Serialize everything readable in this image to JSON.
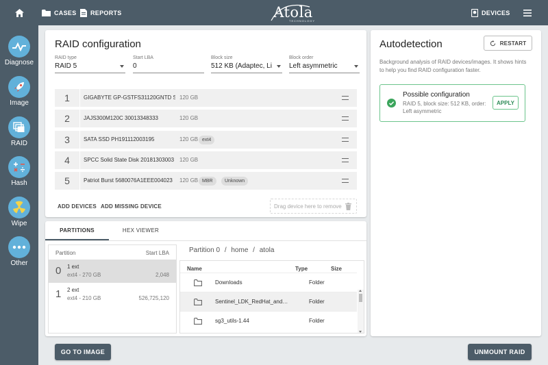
{
  "topbar": {
    "cases_label": "CASES",
    "reports_label": "REPORTS",
    "logo_text": "Atola",
    "logo_sub": "TECHNOLOGY",
    "devices_label": "DEVICES",
    "home_icon": "home-icon",
    "menu_icon": "hamburger-menu-icon"
  },
  "sidebar": {
    "items": [
      {
        "label": "Diagnose",
        "icon": "diagnose-icon"
      },
      {
        "label": "Image",
        "icon": "rocket-icon"
      },
      {
        "label": "RAID",
        "icon": "raid-stack-icon"
      },
      {
        "label": "Hash",
        "icon": "hash-math-icon"
      },
      {
        "label": "Wipe",
        "icon": "radiation-icon"
      },
      {
        "label": "Other",
        "icon": "more-dots-icon"
      }
    ],
    "accent": "#62b1da"
  },
  "raid": {
    "title": "RAID configuration",
    "fields": {
      "type": {
        "label": "RAID type",
        "value": "RAID 5"
      },
      "start_lba": {
        "label": "Start LBA",
        "value": "0"
      },
      "block_size": {
        "label": "Block size",
        "value": "512 KB (Adaptec, Li..."
      },
      "block_order": {
        "label": "Block order",
        "value": "Left asymmetric"
      }
    },
    "devices": [
      {
        "num": "1",
        "name": "GIGABYTE GP-GSTFS31120GNTD S",
        "size": "120 GB",
        "tags": []
      },
      {
        "num": "2",
        "name": "JAJS300M120C 30013348333",
        "size": "120 GB",
        "tags": []
      },
      {
        "num": "3",
        "name": "SATA SSD PH191112003195",
        "size": "120 GB",
        "tags": [
          "ext4"
        ]
      },
      {
        "num": "4",
        "name": "SPCC Solid State Disk 20181303003",
        "size": "120 GB",
        "tags": []
      },
      {
        "num": "5",
        "name": "Patriot Burst 5680076A1EEE004023",
        "size": "120 GB",
        "tags": [
          "MBR",
          "Unknown"
        ]
      }
    ],
    "add_devices": "ADD DEVICES",
    "add_missing": "ADD MISSING DEVICE",
    "drop_hint": "Drag device here to remove"
  },
  "auto": {
    "title": "Autodetection",
    "restart": "RESTART",
    "desc": "Background analysis of RAID devices/images. It shows hints to help you find RAID configuration faster.",
    "config_title": "Possible configuration",
    "config_desc": "RAID 5, block size: 512 KB, order: Left asymmetric",
    "apply": "APPLY",
    "success_color": "#3ba55c"
  },
  "partitions": {
    "tabs": [
      "PARTITIONS",
      "HEX VIEWER"
    ],
    "col_partition": "Partition",
    "col_start": "Start LBA",
    "rows": [
      {
        "num": "0",
        "name": "1 ext",
        "info": "ext4 - 270 GB",
        "lba": "2,048"
      },
      {
        "num": "1",
        "name": "2 ext",
        "info": "ext4 - 210 GB",
        "lba": "526,725,120"
      }
    ],
    "breadcrumb": [
      "Partition 0",
      "/",
      "home",
      "/",
      "atola"
    ],
    "file_cols": {
      "name": "Name",
      "type": "Type",
      "size": "Size"
    },
    "files": [
      {
        "name": "Downloads",
        "type": "Folder"
      },
      {
        "name": "Sentinel_LDK_RedHat_and..._RPM",
        "type": "Folder"
      },
      {
        "name": "sg3_utils-1.44",
        "type": "Folder"
      }
    ]
  },
  "bottom": {
    "go_to_image": "GO TO IMAGE",
    "unmount": "UNMOUNT RAID"
  }
}
